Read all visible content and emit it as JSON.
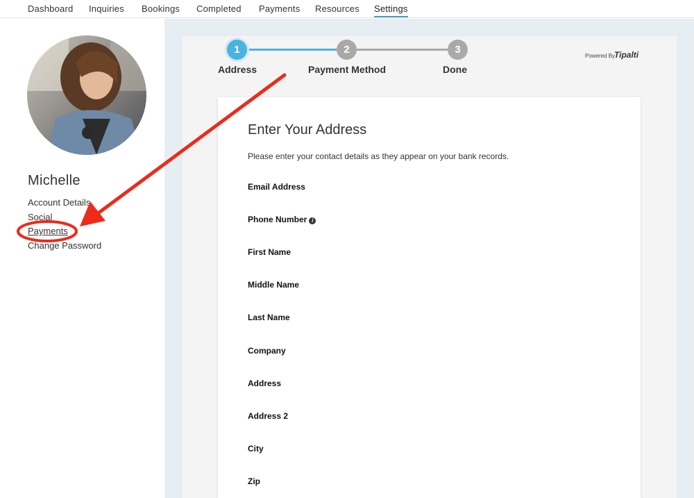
{
  "nav": {
    "items": [
      {
        "label": "Dashboard"
      },
      {
        "label": "Inquiries"
      },
      {
        "label": "Bookings"
      },
      {
        "label": "Completed"
      },
      {
        "label": "Payments"
      },
      {
        "label": "Resources"
      },
      {
        "label": "Settings",
        "active": true
      }
    ]
  },
  "profile": {
    "name": "Michelle",
    "links": [
      {
        "label": "Account Details"
      },
      {
        "label": "Social"
      },
      {
        "label": "Payments",
        "highlighted": true
      },
      {
        "label": "Change Password"
      }
    ]
  },
  "stepper": {
    "steps": [
      {
        "number": "1",
        "label": "Address",
        "state": "active"
      },
      {
        "number": "2",
        "label": "Payment Method",
        "state": "pending"
      },
      {
        "number": "3",
        "label": "Done",
        "state": "pending"
      }
    ]
  },
  "powered_by": {
    "prefix": "Powered By",
    "brand": "Tipalti"
  },
  "form": {
    "title": "Enter Your Address",
    "description": "Please enter your contact details as they appear on your bank records.",
    "fields": [
      {
        "label": "Email Address"
      },
      {
        "label": "Phone Number",
        "info_icon": true
      },
      {
        "label": "First Name"
      },
      {
        "label": "Middle Name"
      },
      {
        "label": "Last Name"
      },
      {
        "label": "Company"
      },
      {
        "label": "Address"
      },
      {
        "label": "Address 2"
      },
      {
        "label": "City"
      },
      {
        "label": "Zip"
      }
    ]
  },
  "colors": {
    "accent": "#3fa2c6",
    "step_active": "#4ab3e0",
    "step_inactive": "#a9a9a9",
    "annotation": "#ee2a1b"
  }
}
